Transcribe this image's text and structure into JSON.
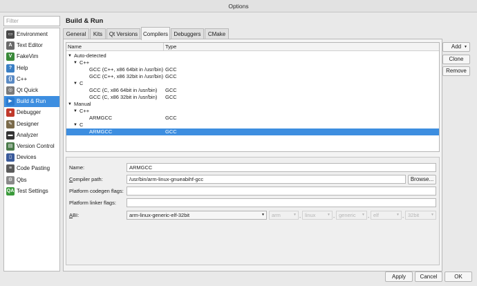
{
  "window": {
    "title": "Options"
  },
  "filter": {
    "placeholder": "Filter"
  },
  "sidebar": {
    "items": [
      {
        "label": "Environment",
        "icon": "monitor-icon",
        "color": "#4a4a4a",
        "glyph": "▭"
      },
      {
        "label": "Text Editor",
        "icon": "text-editor-icon",
        "color": "#6a6a6a",
        "glyph": "A"
      },
      {
        "label": "FakeVim",
        "icon": "fakevim-icon",
        "color": "#3a8a3a",
        "glyph": "V"
      },
      {
        "label": "Help",
        "icon": "help-icon",
        "color": "#3b7fc4",
        "glyph": "?"
      },
      {
        "label": "C++",
        "icon": "cpp-icon",
        "color": "#5a8ac4",
        "glyph": "{}"
      },
      {
        "label": "Qt Quick",
        "icon": "qt-quick-icon",
        "color": "#7a7a7a",
        "glyph": "◎"
      },
      {
        "label": "Build & Run",
        "icon": "build-run-icon",
        "color": "#2b7bd0",
        "glyph": "▶"
      },
      {
        "label": "Debugger",
        "icon": "debugger-icon",
        "color": "#c0392b",
        "glyph": "●"
      },
      {
        "label": "Designer",
        "icon": "designer-icon",
        "color": "#7a6a4a",
        "glyph": "✎"
      },
      {
        "label": "Analyzer",
        "icon": "analyzer-icon",
        "color": "#333333",
        "glyph": "▬"
      },
      {
        "label": "Version Control",
        "icon": "version-control-icon",
        "color": "#4a7a4a",
        "glyph": "▤"
      },
      {
        "label": "Devices",
        "icon": "devices-icon",
        "color": "#3a5a9a",
        "glyph": "▯"
      },
      {
        "label": "Code Pasting",
        "icon": "code-pasting-icon",
        "color": "#5a5a5a",
        "glyph": "≡"
      },
      {
        "label": "Qbs",
        "icon": "qbs-icon",
        "color": "#8a8a8a",
        "glyph": "⚙"
      },
      {
        "label": "Test Settings",
        "icon": "test-settings-icon",
        "color": "#3a9a3a",
        "glyph": "QA"
      }
    ],
    "selected_index": 6
  },
  "page": {
    "title": "Build & Run"
  },
  "tabs": [
    "General",
    "Kits",
    "Qt Versions",
    "Compilers",
    "Debuggers",
    "CMake"
  ],
  "active_tab": "Compilers",
  "tree": {
    "columns": [
      "Name",
      "Type"
    ],
    "rows": [
      {
        "name": "Auto-detected",
        "type": "",
        "level": 0,
        "expanded": true
      },
      {
        "name": "C++",
        "type": "",
        "level": 1,
        "expanded": true
      },
      {
        "name": "GCC (C++, x86 64bit in /usr/bin)",
        "type": "GCC",
        "level": 2
      },
      {
        "name": "GCC (C++, x86 32bit in /usr/bin)",
        "type": "GCC",
        "level": 2
      },
      {
        "name": "C",
        "type": "",
        "level": 1,
        "expanded": true
      },
      {
        "name": "GCC (C, x86 64bit in /usr/bin)",
        "type": "GCC",
        "level": 2
      },
      {
        "name": "GCC (C, x86 32bit in /usr/bin)",
        "type": "GCC",
        "level": 2
      },
      {
        "name": "Manual",
        "type": "",
        "level": 0,
        "expanded": true
      },
      {
        "name": "C++",
        "type": "",
        "level": 1,
        "expanded": true
      },
      {
        "name": "ARMGCC",
        "type": "GCC",
        "level": 2
      },
      {
        "name": "C",
        "type": "",
        "level": 1,
        "expanded": true
      },
      {
        "name": "ARMGCC",
        "type": "GCC",
        "level": 2,
        "selected": true
      }
    ]
  },
  "side_buttons": {
    "add": "Add",
    "clone": "Clone",
    "remove": "Remove"
  },
  "details": {
    "name_label": "Name:",
    "name_value": "ARMGCC",
    "path_label": "Compiler path:",
    "path_value": "/usr/bin/arm-linux-gnueabihf-gcc",
    "browse": "Browse...",
    "codegen_label": "Platform codegen flags:",
    "codegen_value": "",
    "linker_label": "Platform linker flags:",
    "linker_value": "",
    "abi_label": "ABI:",
    "abi_value": "arm-linux-generic-elf-32bit",
    "abi_parts": [
      "arm",
      "linux",
      "generic",
      "elf",
      "32bit"
    ]
  },
  "footer": {
    "apply": "Apply",
    "cancel": "Cancel",
    "ok": "OK"
  },
  "colors": {
    "selection": "#3d8ee0"
  }
}
